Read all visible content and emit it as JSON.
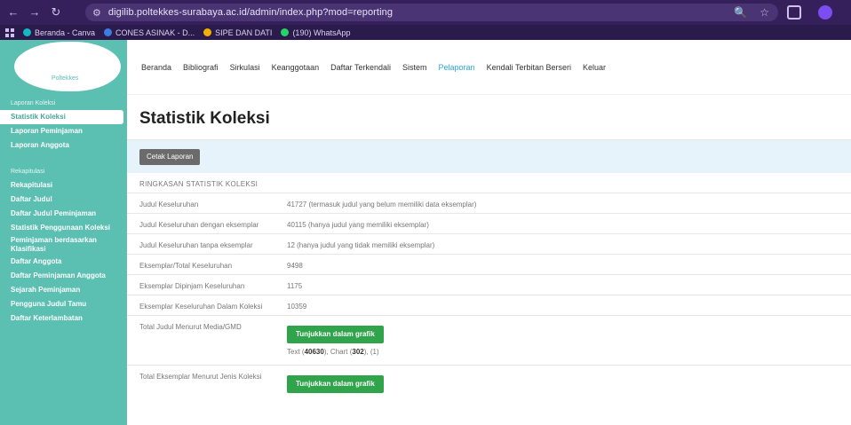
{
  "browser": {
    "url": "digilib.poltekkes-surabaya.ac.id/admin/index.php?mod=reporting",
    "bookmarks": [
      "Beranda - Canva",
      "CONES ASINAK - D...",
      "SIPE DAN DATI",
      "(190) WhatsApp"
    ]
  },
  "sidebar": {
    "logo_text": "Poltekkes",
    "section_1": "Laporan Koleksi",
    "items_1": [
      "Statistik Koleksi",
      "Laporan Peminjaman",
      "Laporan Anggota"
    ],
    "section_2": "Rekapitulasi",
    "items_2": [
      "Rekapitulasi",
      "Daftar Judul",
      "Daftar Judul Peminjaman",
      "Statistik Penggunaan Koleksi",
      "Peminjaman berdasarkan Klasifikasi",
      "Daftar Anggota",
      "Daftar Peminjaman Anggota",
      "Sejarah Peminjaman",
      "Pengguna Judul Tamu",
      "Daftar Keterlambatan"
    ]
  },
  "topnav": [
    "Beranda",
    "Bibliografi",
    "Sirkulasi",
    "Keanggotaan",
    "Daftar Terkendali",
    "Sistem",
    "Pelaporan",
    "Kendali Terbitan Berseri",
    "Keluar"
  ],
  "main": {
    "title": "Statistik Koleksi",
    "print_label": "Cetak Laporan",
    "section_head": "RINGKASAN STATISTIK KOLEKSI",
    "rows": [
      {
        "label": "Judul Keseluruhan",
        "value": "41727 (termasuk judul yang belum memiliki data eksemplar)"
      },
      {
        "label": "Judul Keseluruhan dengan eksemplar",
        "value": "40115 (hanya judul yang memiliki eksemplar)"
      },
      {
        "label": "Judul Keseluruhan tanpa eksemplar",
        "value": "12 (hanya judul yang tidak memiliki eksemplar)"
      },
      {
        "label": "Eksemplar/Total Keseluruhan",
        "value": "9498"
      },
      {
        "label": "Eksemplar Dipinjam Keseluruhan",
        "value": "1175"
      },
      {
        "label": "Eksemplar Keseluruhan Dalam Koleksi",
        "value": "10359"
      }
    ],
    "graph_rows": [
      {
        "label": "Total Judul Menurut Media/GMD",
        "button": "Tunjukkan dalam grafik",
        "sub_prefix": "Text (",
        "sub_a": "40630",
        "sub_mid": "), Chart (",
        "sub_b": "302",
        "sub_suffix": "), (1)"
      },
      {
        "label": "Total Eksemplar Menurut Jenis Koleksi",
        "button": "Tunjukkan dalam grafik"
      }
    ]
  }
}
